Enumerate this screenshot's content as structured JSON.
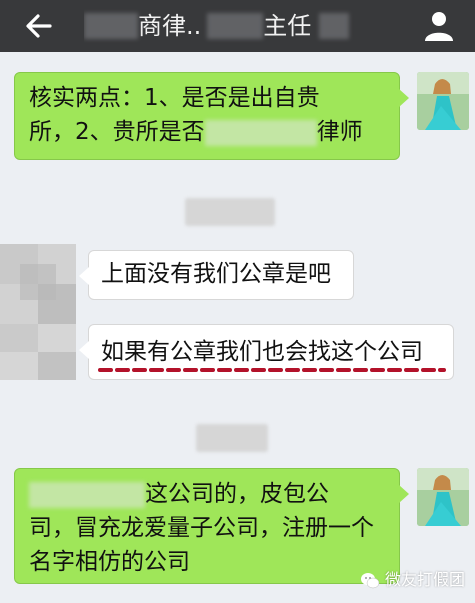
{
  "header": {
    "title_fragment": "商律..",
    "title_suffix": "主任"
  },
  "messages": [
    {
      "id": "m1",
      "side": "right",
      "style": "green",
      "line1": "核实两点：1、是否是出自贵",
      "line2_before": "所，2、贵所是否",
      "line2_after": "律师"
    },
    {
      "id": "m2",
      "side": "left",
      "style": "white",
      "text": "上面没有我们公章是吧"
    },
    {
      "id": "m3",
      "side": "left",
      "style": "white",
      "text": "如果有公章我们也会找这个公司"
    },
    {
      "id": "m4",
      "side": "right",
      "style": "green",
      "line1_after": "这公司的，皮包公",
      "line2": "司，冒充龙爱量子公司，注册一个",
      "line3": "名字相仿的公司"
    }
  ],
  "watermark": "微友打假团",
  "colors": {
    "topbar": "#38393b",
    "background": "#eceff3",
    "green_bubble": "#9fe659",
    "underline": "#b3122a"
  },
  "icons": {
    "back": "arrow-left-icon",
    "user": "person-icon",
    "watermark": "wechat-icon"
  }
}
